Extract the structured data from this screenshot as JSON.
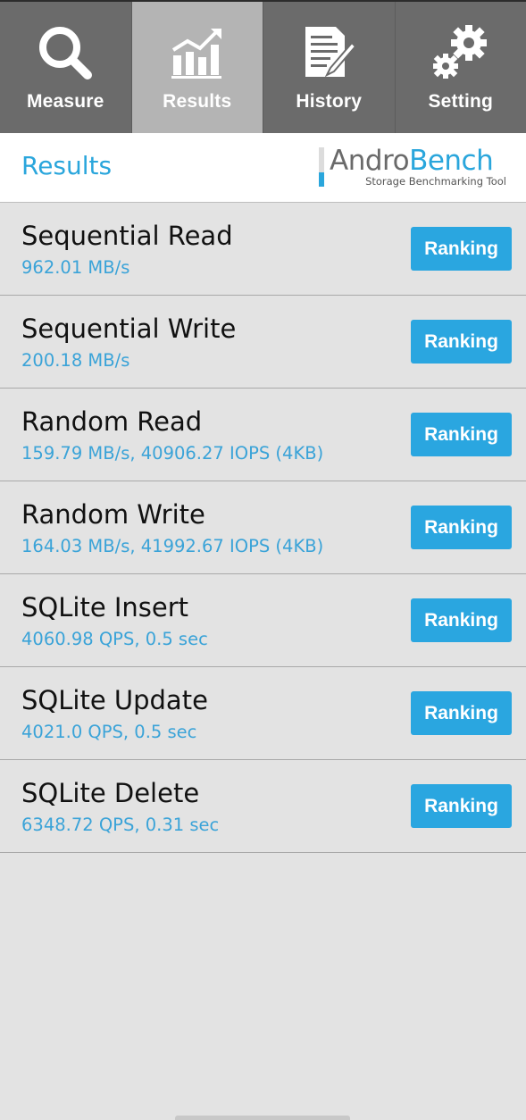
{
  "tabs": [
    {
      "label": "Measure",
      "icon": "magnifier-icon",
      "active": false
    },
    {
      "label": "Results",
      "icon": "chart-icon",
      "active": true
    },
    {
      "label": "History",
      "icon": "document-pen-icon",
      "active": false
    },
    {
      "label": "Setting",
      "icon": "gears-icon",
      "active": false
    }
  ],
  "header": {
    "title": "Results",
    "logo_part1": "Andro",
    "logo_part2": "Bench",
    "tagline": "Storage Benchmarking Tool"
  },
  "results": [
    {
      "name": "Sequential Read",
      "value": "962.01 MB/s",
      "button": "Ranking"
    },
    {
      "name": "Sequential Write",
      "value": "200.18 MB/s",
      "button": "Ranking"
    },
    {
      "name": "Random Read",
      "value": "159.79 MB/s, 40906.27 IOPS (4KB)",
      "button": "Ranking"
    },
    {
      "name": "Random Write",
      "value": "164.03 MB/s, 41992.67 IOPS (4KB)",
      "button": "Ranking"
    },
    {
      "name": "SQLite Insert",
      "value": "4060.98 QPS, 0.5 sec",
      "button": "Ranking"
    },
    {
      "name": "SQLite Update",
      "value": "4021.0 QPS, 0.5 sec",
      "button": "Ranking"
    },
    {
      "name": "SQLite Delete",
      "value": "6348.72 QPS, 0.31 sec",
      "button": "Ranking"
    }
  ],
  "colors": {
    "accent": "#2aa6dc",
    "tab_bar": "#6b6b6b",
    "tab_active": "#b4b4b4",
    "background": "#e3e3e3"
  }
}
